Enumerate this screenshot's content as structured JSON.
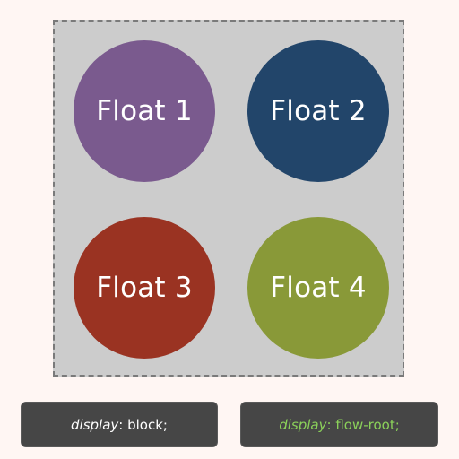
{
  "container": {
    "floats": [
      {
        "label": "Float 1",
        "color": "#7a5a8e"
      },
      {
        "label": "Float 2",
        "color": "#22456a"
      },
      {
        "label": "Float 3",
        "color": "#9a3322"
      },
      {
        "label": "Float 4",
        "color": "#899938"
      }
    ]
  },
  "buttons": {
    "block": {
      "property": "display",
      "value": ": block;"
    },
    "flow_root": {
      "property": "display",
      "value": ": flow-root;",
      "active_color": "#8bd15a"
    }
  },
  "colors": {
    "background": "#fff6f3",
    "container_bg": "#cccccc",
    "button_bg": "#464646"
  }
}
